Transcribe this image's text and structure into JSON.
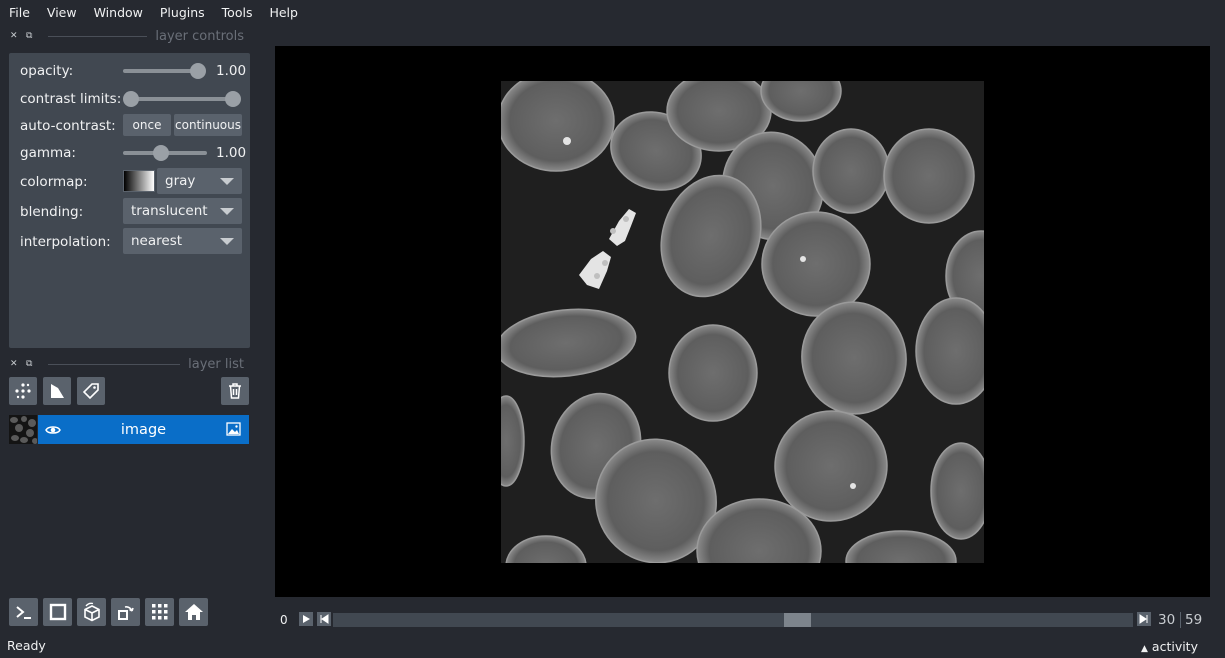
{
  "menu": [
    "File",
    "View",
    "Window",
    "Plugins",
    "Tools",
    "Help"
  ],
  "docks": {
    "layer_controls_title": "layer controls",
    "layer_list_title": "layer list"
  },
  "controls": {
    "opacity": {
      "label": "opacity:",
      "value": "1.00",
      "fraction": 1.0
    },
    "contrast_limits": {
      "label": "contrast limits:",
      "low": 0.0,
      "high": 1.0
    },
    "auto_contrast": {
      "label": "auto-contrast:",
      "once": "once",
      "continuous": "continuous"
    },
    "gamma": {
      "label": "gamma:",
      "value": "1.00",
      "fraction": 0.45
    },
    "colormap": {
      "label": "colormap:",
      "value": "gray"
    },
    "blending": {
      "label": "blending:",
      "value": "translucent"
    },
    "interpolation": {
      "label": "interpolation:",
      "value": "nearest"
    }
  },
  "layer_list": {
    "layers": [
      {
        "name": "image",
        "type_icon": "image-layer-icon",
        "visible": true,
        "selected": true
      }
    ],
    "buttons": [
      "new-points-icon",
      "new-shapes-icon",
      "new-labels-icon",
      "delete-icon"
    ]
  },
  "bottom_tools": [
    "console-icon",
    "ndisplay-square-icon",
    "roll-3d-icon",
    "transpose-icon",
    "grid-icon",
    "home-icon"
  ],
  "dims": {
    "axis": "0",
    "current": "30",
    "max": "59",
    "fraction": 0.508
  },
  "status": {
    "text": "Ready",
    "activity": "activity"
  },
  "colors": {
    "background": "#262930",
    "panel": "#414851",
    "button": "#5a626c",
    "selection": "#0a6ec8",
    "canvas": "#000000"
  }
}
